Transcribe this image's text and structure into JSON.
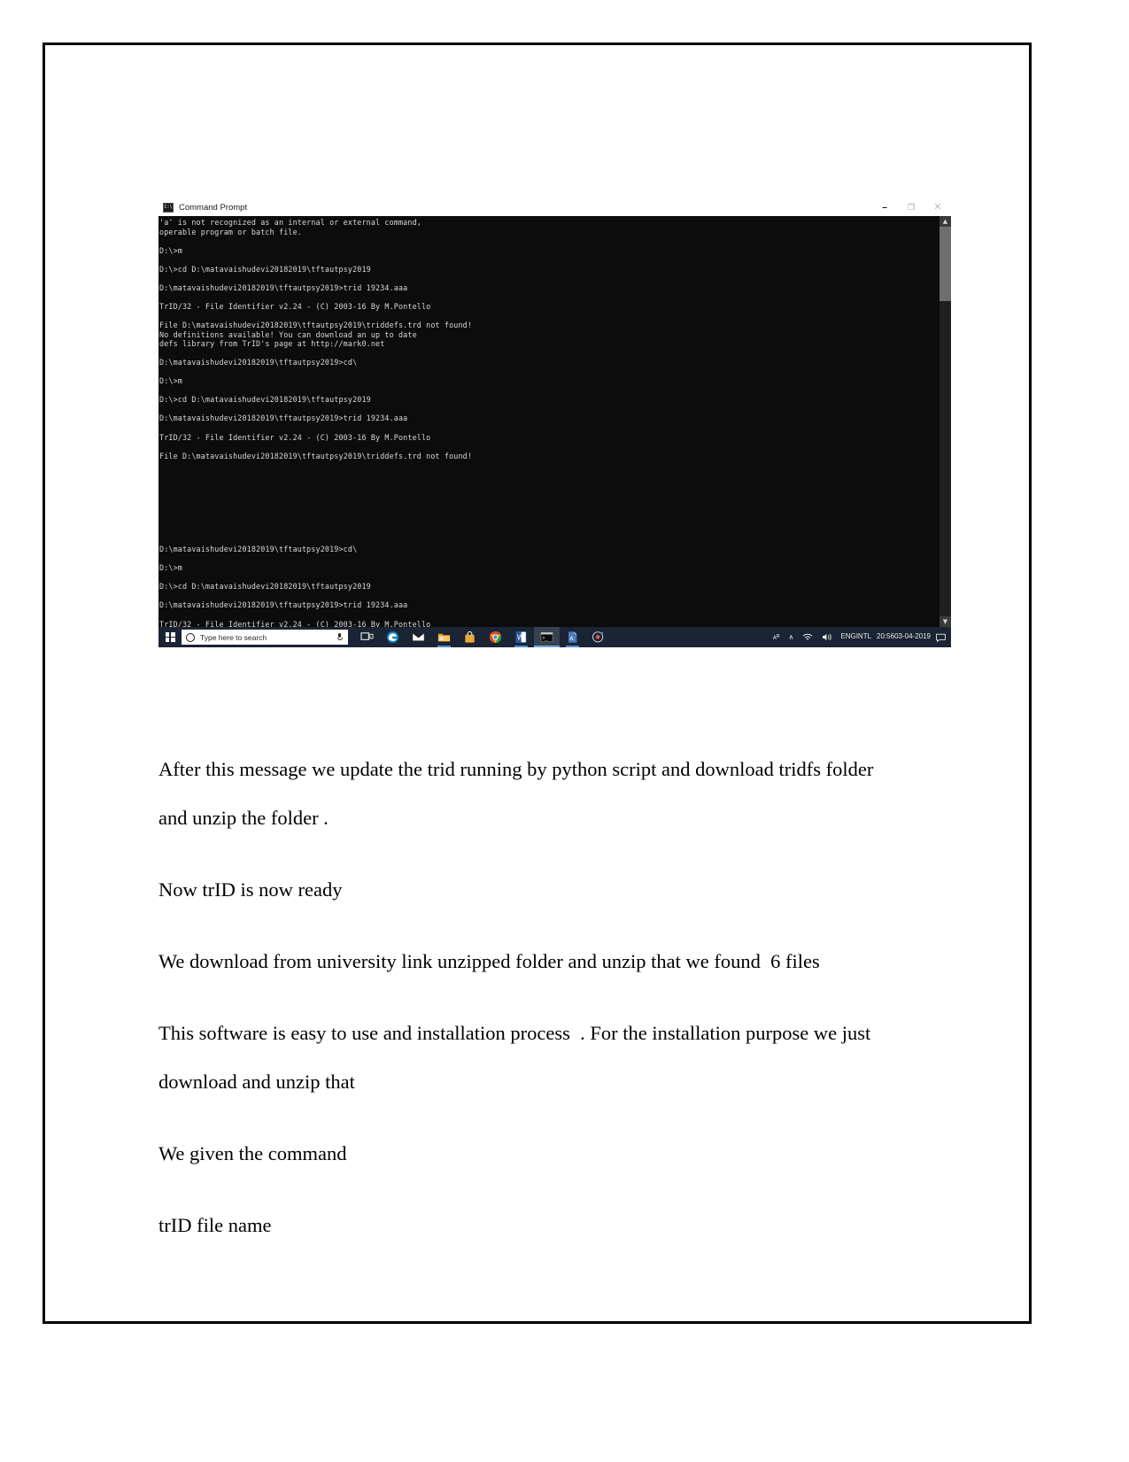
{
  "window": {
    "title": "Command Prompt",
    "icon_glyph": "C:\\",
    "controls": {
      "minimize": "–",
      "maximize": "❐",
      "close": "✕"
    }
  },
  "console": {
    "text": "'a' is not recognized as an internal or external command,\noperable program or batch file.\n\nD:\\>m\n\nD:\\>cd D:\\matavaishudevi20182019\\tftautpsy2019\n\nD:\\matavaishudevi20182019\\tftautpsy2019>trid 19234.aaa\n\nTrID/32 - File Identifier v2.24 - (C) 2003-16 By M.Pontello\n\nFile D:\\matavaishudevi20182019\\tftautpsy2019\\triddefs.trd not found!\nNo definitions available! You can download an up to date\ndefs library from TrID's page at http://mark0.net\n\nD:\\matavaishudevi20182019\\tftautpsy2019>cd\\\n\nD:\\>m\n\nD:\\>cd D:\\matavaishudevi20182019\\tftautpsy2019\n\nD:\\matavaishudevi20182019\\tftautpsy2019>trid 19234.aaa\n\nTrID/32 - File Identifier v2.24 - (C) 2003-16 By M.Pontello\n\nFile D:\\matavaishudevi20182019\\tftautpsy2019\\triddefs.trd not found!\n\n\n\n\n\n\n\n\n\nD:\\matavaishudevi20182019\\tftautpsy2019>cd\\\n\nD:\\>m\n\nD:\\>cd D:\\matavaishudevi20182019\\tftautpsy2019\n\nD:\\matavaishudevi20182019\\tftautpsy2019>trid 19234.aaa\n\nTrID/32 - File Identifier v2.24 - (C) 2003-16 By M.Pontello",
    "scroll_up_glyph": "▲",
    "scroll_down_glyph": "▼"
  },
  "taskbar": {
    "start_label": "Start",
    "search_placeholder": "Type here to search",
    "task_view_label": "Task View",
    "apps": [
      {
        "name": "microsoft-edge",
        "label": "Microsoft Edge"
      },
      {
        "name": "mail",
        "label": "Mail"
      },
      {
        "name": "file-explorer",
        "label": "File Explorer"
      },
      {
        "name": "microsoft-store",
        "label": "Microsoft Store"
      },
      {
        "name": "google-chrome",
        "label": "Google Chrome"
      },
      {
        "name": "microsoft-word",
        "label": "Microsoft Word"
      },
      {
        "name": "command-prompt",
        "label": "Command Prompt"
      },
      {
        "name": "adobe-reader",
        "label": "Adobe Reader"
      },
      {
        "name": "paint-3d",
        "label": "Paint 3D"
      }
    ],
    "tray": {
      "pen_workspace": "ᴀᴿ",
      "show_hidden_glyph": "∧",
      "network_label": "Network",
      "volume_label": "Volume",
      "language_line1": "ENG",
      "language_line2": "INTL",
      "time": "20:56",
      "date": "03-04-2019",
      "action_center_label": "Action Center"
    }
  },
  "document": {
    "paragraphs": [
      "After this message we update the trid running by python script and download tridfs folder",
      "and unzip the folder .",
      "Now trID is now ready",
      "We download from university link unzipped folder and unzip that we found  6 files",
      "This software is easy to use and installation process  . For the installation purpose we just",
      "download and unzip that",
      "We given the command",
      "trID file name"
    ]
  }
}
